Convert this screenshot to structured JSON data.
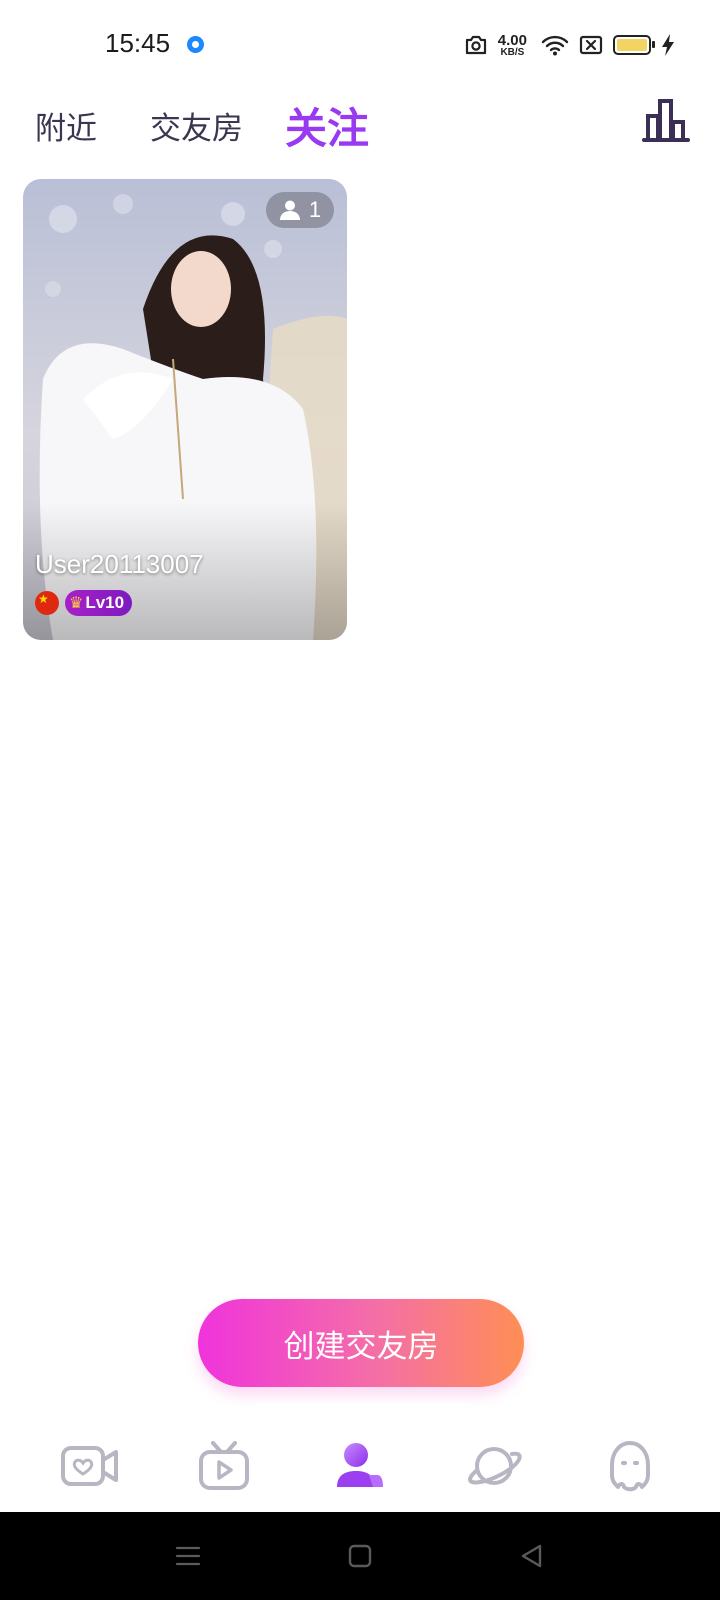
{
  "status_bar": {
    "time": "15:45",
    "speed_value": "4.00",
    "speed_unit": "KB/S",
    "icons": [
      "notification-dot-icon",
      "camera-icon",
      "wifi-icon",
      "sim-off-icon",
      "battery-icon",
      "charging-icon"
    ],
    "battery_color": "#f3d462"
  },
  "top_tabs": {
    "items": [
      {
        "label": "附近",
        "active": false
      },
      {
        "label": "交友房",
        "active": false
      },
      {
        "label": "关注",
        "active": true
      }
    ],
    "active_color": "#9a39f2",
    "rank_icon": "ranking-chart-icon"
  },
  "rooms": [
    {
      "user_name": "User20113007",
      "viewer_count": "1",
      "level": "Lv10",
      "country_flag": "china-flag-icon",
      "photo": "portrait-photo"
    }
  ],
  "create_button": {
    "label": "创建交友房",
    "gradient": [
      "#f033dc",
      "#ff8e55"
    ]
  },
  "bottom_nav": {
    "items": [
      {
        "icon": "live-camera-icon",
        "active": false
      },
      {
        "icon": "tv-play-icon",
        "active": false
      },
      {
        "icon": "party-room-icon",
        "active": true
      },
      {
        "icon": "planet-icon",
        "active": false
      },
      {
        "icon": "ghost-message-icon",
        "active": false
      }
    ],
    "inactive_color": "#b8b6c2",
    "active_color": "#9b3ff0"
  },
  "system_nav": {
    "icons": [
      "menu-icon",
      "home-icon",
      "back-icon"
    ]
  }
}
